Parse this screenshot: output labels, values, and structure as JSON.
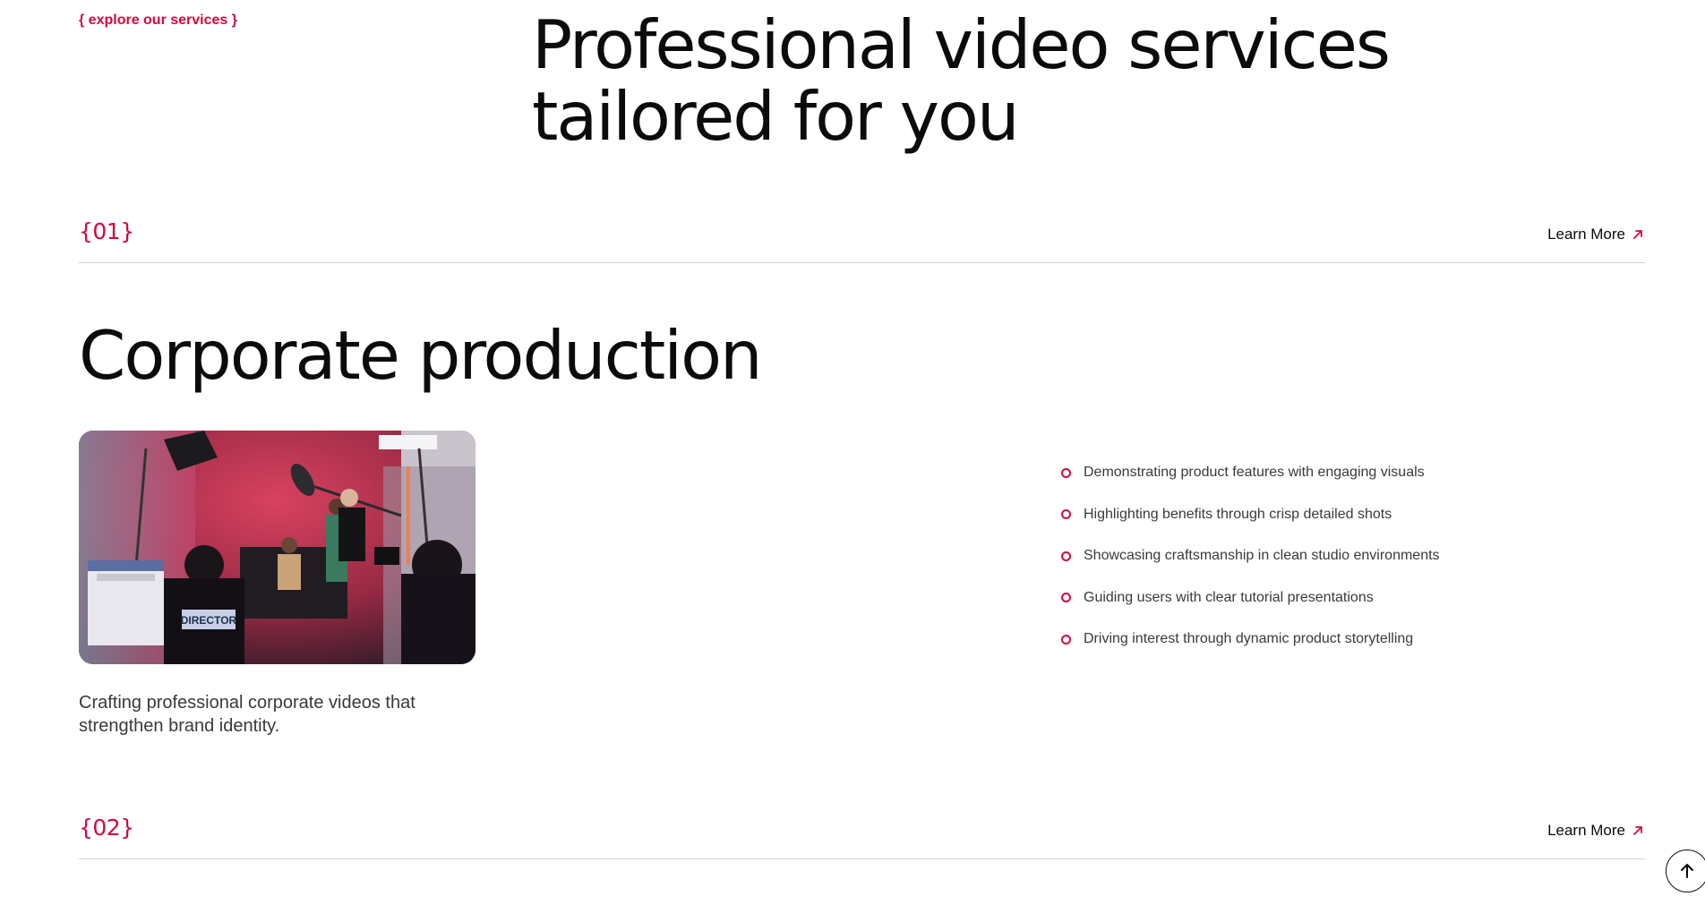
{
  "section": {
    "eyebrow": "{ explore our services }",
    "title_line1": "Professional video services",
    "title_line2": "tailored for you"
  },
  "services": [
    {
      "number": "{01}",
      "learn_more": "Learn More",
      "title": "Corporate production",
      "description": "Crafting professional corporate videos that strengthen brand identity.",
      "image_caption": "DIRECTOR",
      "bullets": [
        "Demonstrating product features with engaging visuals",
        "Highlighting benefits through crisp detailed shots",
        "Showcasing craftsmanship in clean studio environments",
        "Guiding users with clear tutorial presentations",
        "Driving interest through dynamic product storytelling"
      ]
    },
    {
      "number": "{02}",
      "learn_more": "Learn More"
    }
  ],
  "icons": {
    "learn_more": "arrow-up-right-icon",
    "bullet": "circle-bullet-icon",
    "back_to_top": "arrow-up-icon"
  },
  "colors": {
    "accent": "#d4093f",
    "text": "#0b0b0b",
    "muted": "#3a3a3a",
    "divider": "#d2d2d2"
  }
}
